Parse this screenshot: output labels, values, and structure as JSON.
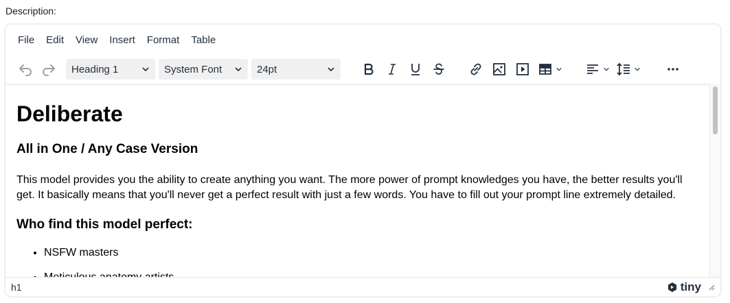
{
  "field_label": "Description:",
  "menubar": {
    "items": [
      "File",
      "Edit",
      "View",
      "Insert",
      "Format",
      "Table"
    ]
  },
  "toolbar": {
    "block_format": "Heading 1",
    "font_family": "System Font",
    "font_size": "24pt"
  },
  "content": {
    "h1": "Deliberate",
    "h3_first": "All in One / Any Case Version",
    "paragraph": "This model provides you the ability to create anything you want. The more power of prompt knowledges you have, the better results you'll get. It basically means that you'll never get a perfect result with just a few words. You have to fill out your prompt line extremely detailed.",
    "h3_second": "Who find this model perfect:",
    "list": [
      "NSFW masters",
      "Meticulous anatomy artists"
    ]
  },
  "statusbar": {
    "path": "h1",
    "brand": "tiny"
  },
  "colors": {
    "text": "#222f3e",
    "select_bg": "#f0f0f0",
    "border": "#eeeeee"
  }
}
